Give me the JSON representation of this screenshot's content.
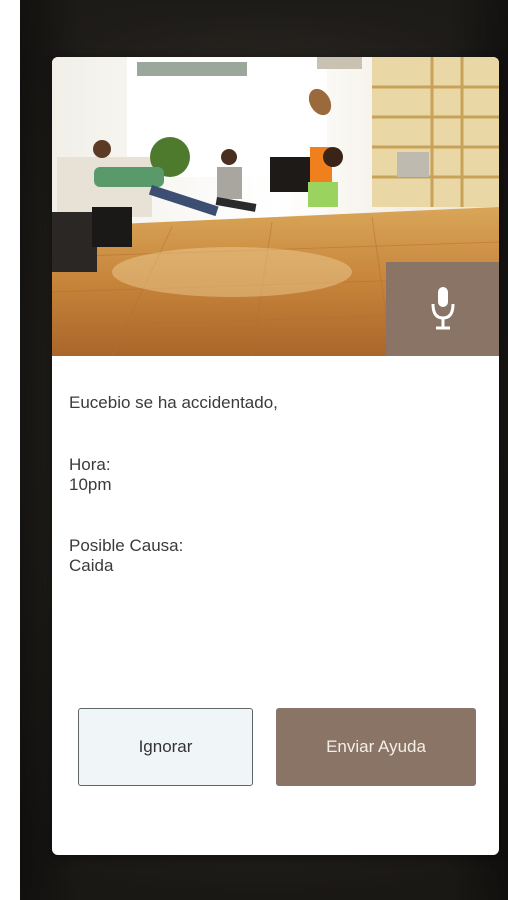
{
  "alert": {
    "message": "Eucebio se ha accidentado,",
    "time_label": "Hora:",
    "time_value": "10pm",
    "cause_label": "Posible Causa:",
    "cause_value": "Caida"
  },
  "actions": {
    "ignore_label": "Ignorar",
    "send_help_label": "Enviar Ayuda"
  },
  "icons": {
    "microphone": "microphone-icon"
  },
  "colors": {
    "accent": "#8a7465",
    "ignore_bg": "#f0f5f8",
    "card_bg": "#ffffff"
  }
}
